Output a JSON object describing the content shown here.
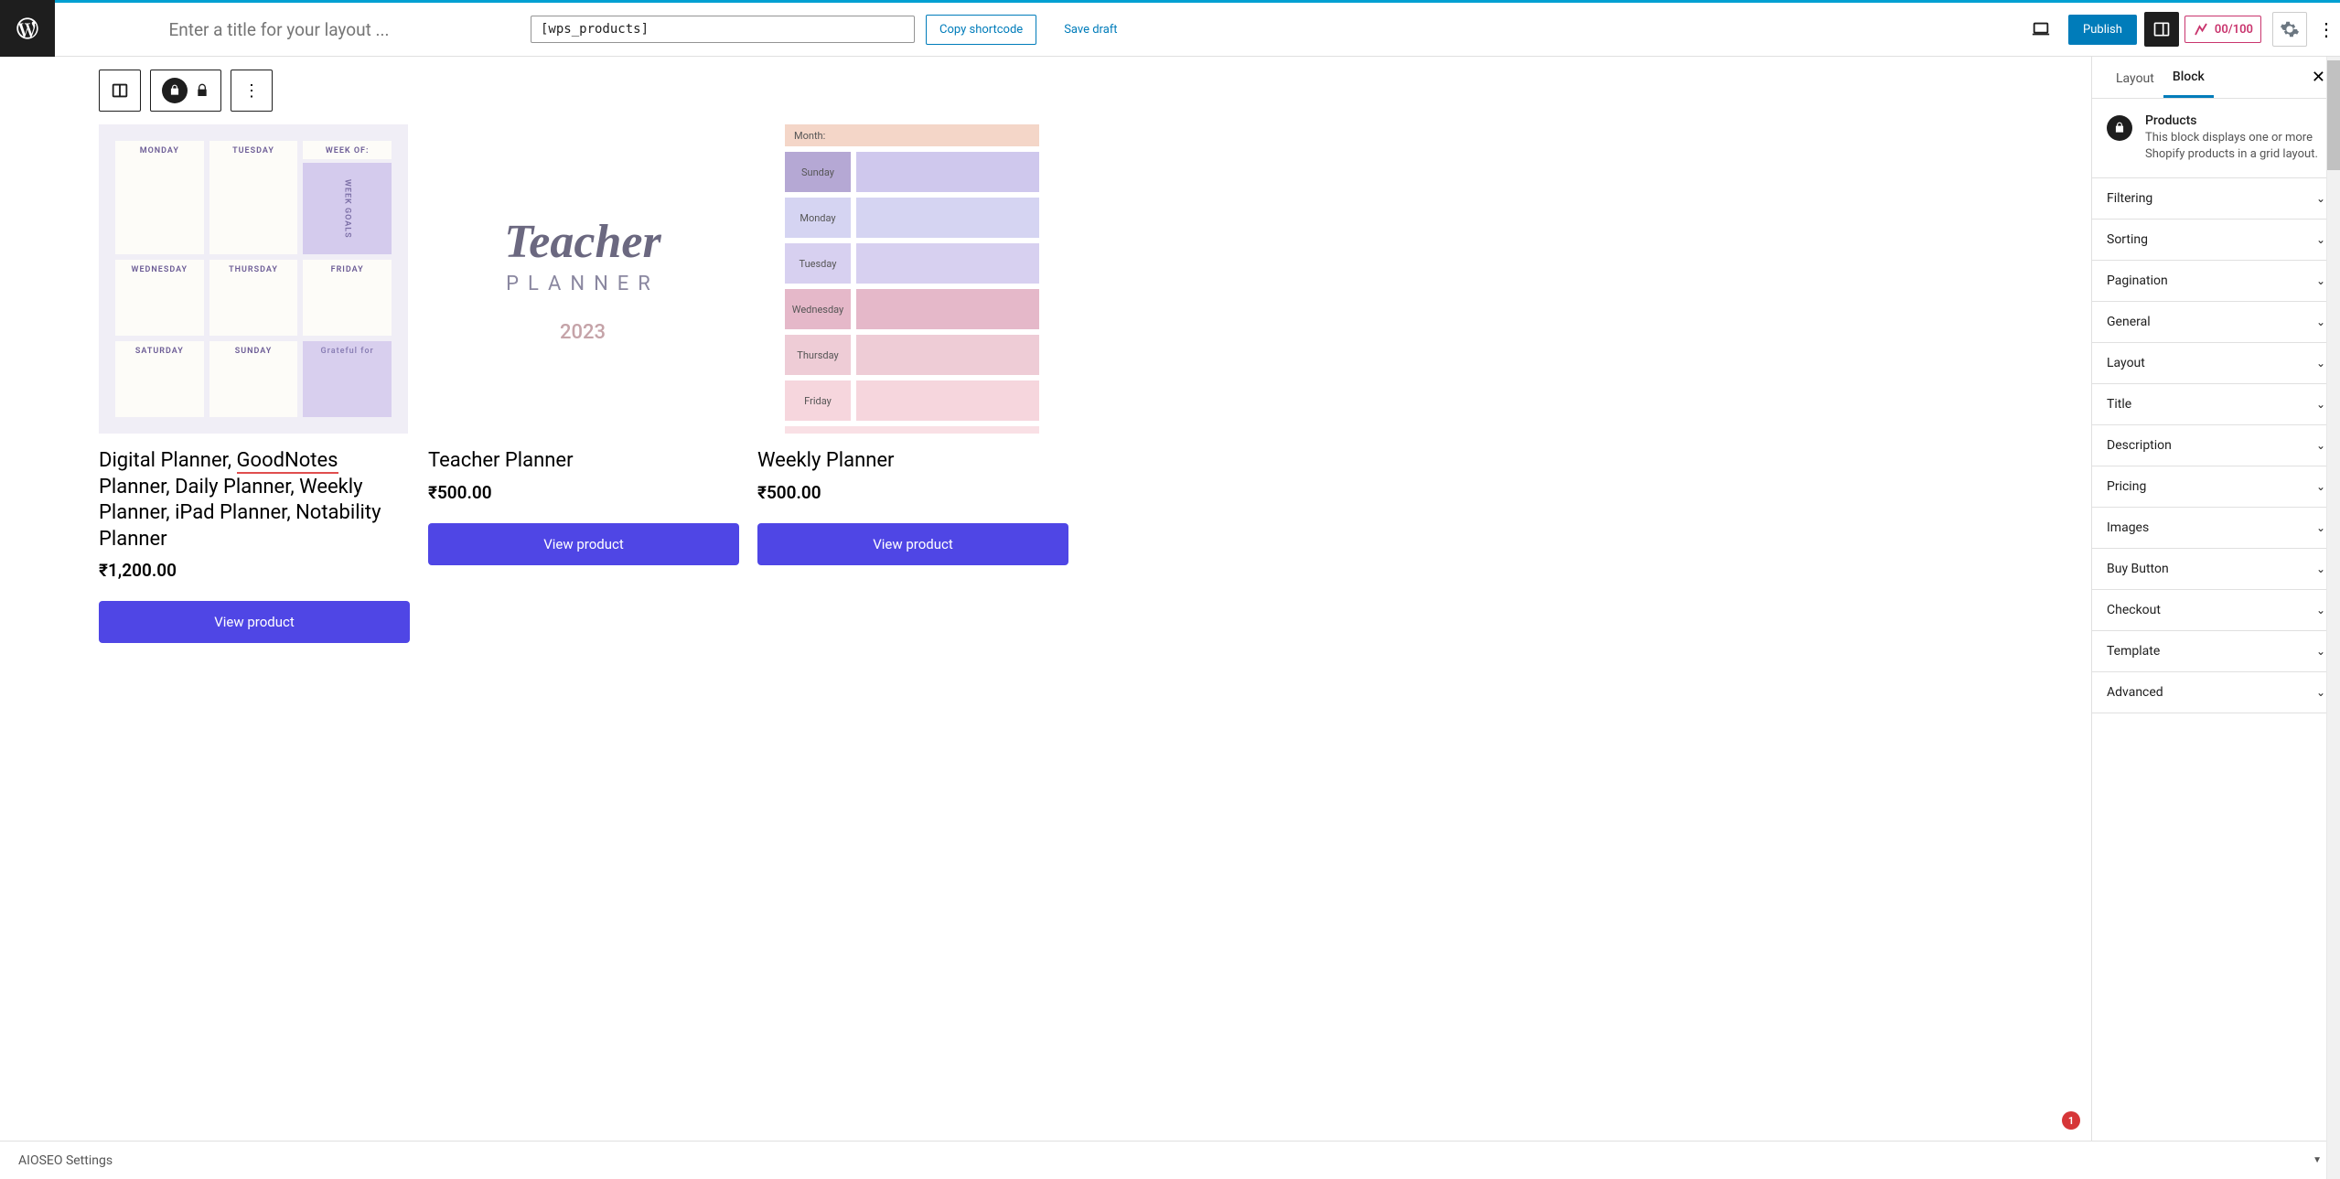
{
  "top": {
    "title_placeholder": "Enter a title for your layout ...",
    "shortcode": "[wps_products]",
    "copy_label": "Copy shortcode",
    "save_draft": "Save draft",
    "publish": "Publish",
    "score": "00/100"
  },
  "sidebar": {
    "tabs": {
      "layout": "Layout",
      "block": "Block"
    },
    "block_info": {
      "title": "Products",
      "desc": "This block displays one or more Shopify products in a grid layout."
    },
    "panels": [
      "Filtering",
      "Sorting",
      "Pagination",
      "General",
      "Layout",
      "Title",
      "Description",
      "Pricing",
      "Images",
      "Buy Button",
      "Checkout",
      "Template",
      "Advanced"
    ]
  },
  "products": [
    {
      "title_pre": "Digital Planner, ",
      "title_underlined": "GoodNotes",
      "title_post": " Planner, Daily Planner, Weekly Planner, iPad Planner, Notability Planner",
      "price": "₹1,200.00",
      "button": "View product",
      "img_type": "weekly",
      "weekly_labels": {
        "monday": "MONDAY",
        "tuesday": "TUESDAY",
        "weekof": "WEEK OF:",
        "wednesday": "WEDNESDAY",
        "thursday": "THURSDAY",
        "friday": "FRIDAY",
        "saturday": "SATURDAY",
        "sunday": "SUNDAY",
        "grateful": "Grateful for",
        "goals": "WEEK GOALS"
      }
    },
    {
      "title": "Teacher Planner",
      "price": "₹500.00",
      "button": "View product",
      "img_type": "teacher",
      "teacher": {
        "script": "Teacher",
        "sub": "PLANNER",
        "year": "2023"
      }
    },
    {
      "title": "Weekly Planner",
      "price": "₹500.00",
      "button": "View product",
      "img_type": "month",
      "month_labels": {
        "month": "Month:",
        "sunday": "Sunday",
        "monday": "Monday",
        "tuesday": "Tuesday",
        "wednesday": "Wednesday",
        "thursday": "Thursday",
        "friday": "Friday"
      }
    }
  ],
  "footer": {
    "label": "AIOSEO Settings",
    "badge": "1"
  }
}
